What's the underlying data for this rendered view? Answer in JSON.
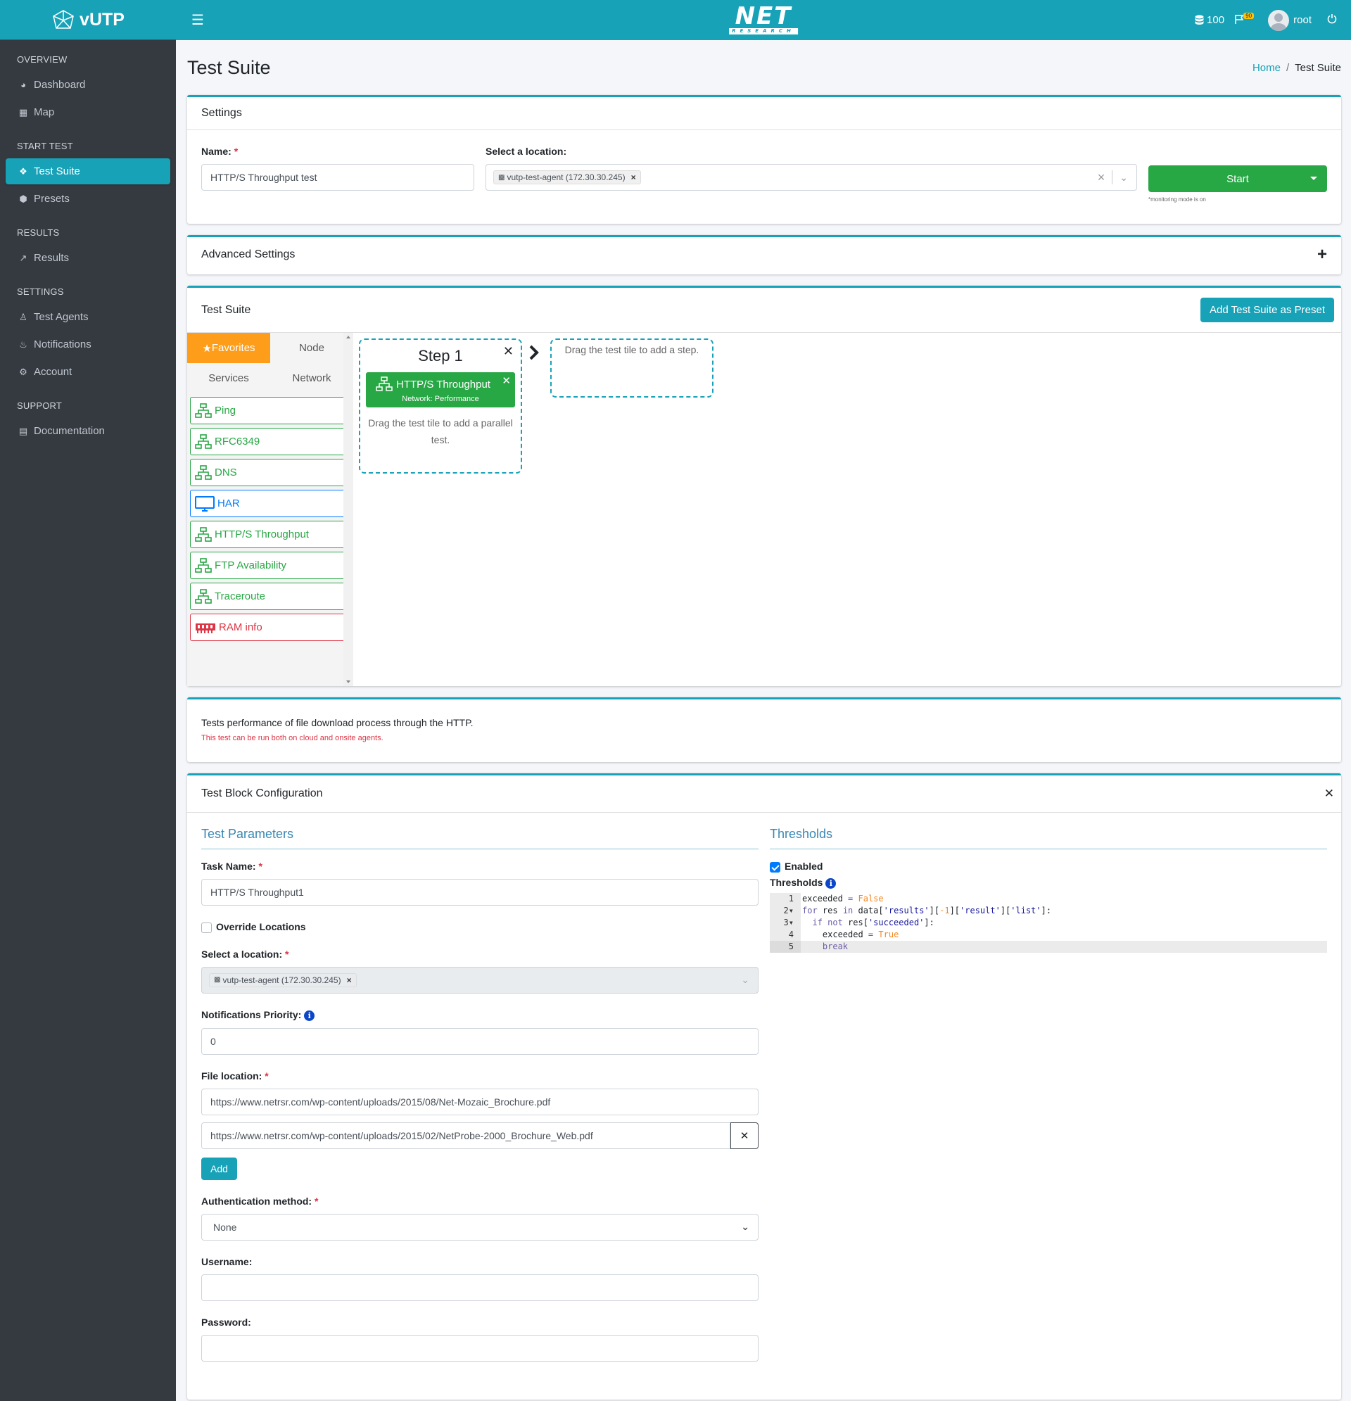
{
  "brand": {
    "name": "vUTP"
  },
  "sidebar": {
    "sections": [
      {
        "header": "OVERVIEW",
        "items": [
          {
            "label": "Dashboard",
            "icon": "dashboard-icon"
          },
          {
            "label": "Map",
            "icon": "map-icon"
          }
        ]
      },
      {
        "header": "START TEST",
        "items": [
          {
            "label": "Test Suite",
            "icon": "cubes-icon",
            "active": true
          },
          {
            "label": "Presets",
            "icon": "cube-icon"
          }
        ]
      },
      {
        "header": "RESULTS",
        "items": [
          {
            "label": "Results",
            "icon": "chart-line-icon"
          }
        ]
      },
      {
        "header": "SETTINGS",
        "items": [
          {
            "label": "Test Agents",
            "icon": "user-secret-icon"
          },
          {
            "label": "Notifications",
            "icon": "bell-icon"
          },
          {
            "label": "Account",
            "icon": "gear-icon"
          }
        ]
      },
      {
        "header": "SUPPORT",
        "items": [
          {
            "label": "Documentation",
            "icon": "file-icon"
          }
        ]
      }
    ]
  },
  "topbar": {
    "logo_text": "NET",
    "logo_sub": "RESEARCH",
    "credits": "100",
    "flag_badge": "90",
    "user": "root"
  },
  "page": {
    "title": "Test Suite",
    "breadcrumb": {
      "home": "Home",
      "current": "Test Suite"
    }
  },
  "settings": {
    "header": "Settings",
    "name_label": "Name:",
    "name_value": "HTTP/S Throughput test",
    "location_label": "Select a location:",
    "location_tag": "vutp-test-agent (172.30.30.245)",
    "start_label": "Start",
    "monitoring_note": "*monitoring mode is on"
  },
  "advanced": {
    "header": "Advanced Settings"
  },
  "suite": {
    "header": "Test Suite",
    "add_preset": "Add Test Suite as Preset",
    "tabs": [
      "Favorites",
      "Node",
      "Services",
      "Network"
    ],
    "tiles": [
      {
        "label": "Ping",
        "color": "green"
      },
      {
        "label": "RFC6349",
        "color": "green"
      },
      {
        "label": "DNS",
        "color": "green"
      },
      {
        "label": "HAR",
        "color": "blue"
      },
      {
        "label": "HTTP/S Throughput",
        "color": "green"
      },
      {
        "label": "FTP Availability",
        "color": "green"
      },
      {
        "label": "Traceroute",
        "color": "green"
      },
      {
        "label": "RAM info",
        "color": "red"
      }
    ],
    "step_title": "Step 1",
    "active_test": "HTTP/S Throughput",
    "active_test_sub": "Network: Performance",
    "parallel_hint": "Drag the test tile to add a parallel test.",
    "step_hint": "Drag the test tile to add a step."
  },
  "description": {
    "text": "Tests performance of file download process through the HTTP.",
    "note": "This test can be run both on cloud and onsite agents."
  },
  "config": {
    "header": "Test Block Configuration",
    "params_title": "Test Parameters",
    "task_name_label": "Task Name:",
    "task_name_value": "HTTP/S Throughput1",
    "override_label": "Override Locations",
    "location_label": "Select a location:",
    "location_tag": "vutp-test-agent (172.30.30.245)",
    "priority_label": "Notifications Priority:",
    "priority_value": "0",
    "file_label": "File location:",
    "file_1": "https://www.netrsr.com/wp-content/uploads/2015/08/Net-Mozaic_Brochure.pdf",
    "file_2": "https://www.netrsr.com/wp-content/uploads/2015/02/NetProbe-2000_Brochure_Web.pdf",
    "add_label": "Add",
    "auth_label": "Authentication method:",
    "auth_value": "None",
    "username_label": "Username:",
    "password_label": "Password:",
    "thresholds_title": "Thresholds",
    "enabled_label": "Enabled",
    "thresholds_label": "Thresholds"
  },
  "code_lines": [
    "exceeded = False",
    "for res in data['results'][-1]['result']['list']:",
    "  if not res['succeeded']:",
    "    exceeded = True",
    "    break"
  ]
}
